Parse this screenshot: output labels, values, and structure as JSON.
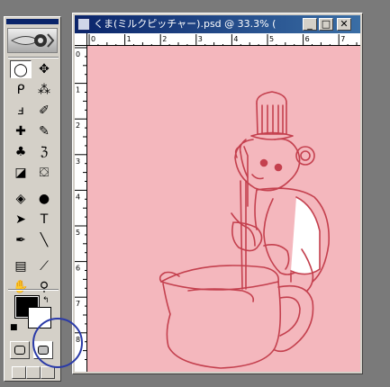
{
  "document": {
    "title": "くま(ミルクピッチャー).psd @ 33.3% (",
    "zoom": "33.3%",
    "canvas_color": "#f4b7bd",
    "line_color": "#c4404e"
  },
  "window_controls": {
    "minimize": "_",
    "maximize": "□",
    "close": "✕"
  },
  "rulers": {
    "horizontal": [
      "0",
      "1",
      "2",
      "3",
      "4",
      "5",
      "6",
      "7"
    ],
    "vertical": [
      "0",
      "1",
      "2",
      "3",
      "4",
      "5",
      "6",
      "7",
      "8"
    ]
  },
  "toolbox": {
    "tools": [
      {
        "name": "marquee-tool",
        "glyph": "◯",
        "selected": true
      },
      {
        "name": "move-tool",
        "glyph": "✥"
      },
      {
        "name": "lasso-tool",
        "glyph": "ᑭ"
      },
      {
        "name": "magic-wand-tool",
        "glyph": "⁂"
      },
      {
        "name": "crop-tool",
        "glyph": "ⅎ"
      },
      {
        "name": "slice-tool",
        "glyph": "✐"
      },
      {
        "name": "healing-brush-tool",
        "glyph": "✚"
      },
      {
        "name": "brush-tool",
        "glyph": "✎"
      },
      {
        "name": "stamp-tool",
        "glyph": "♣"
      },
      {
        "name": "history-brush-tool",
        "glyph": "ℨ"
      },
      {
        "name": "eraser-tool",
        "glyph": "◪"
      },
      {
        "name": "paint-bucket-tool",
        "glyph": "⛋"
      },
      {
        "name": "blur-tool",
        "glyph": "◈"
      },
      {
        "name": "dodge-tool",
        "glyph": "●"
      },
      {
        "name": "path-selection-tool",
        "glyph": "➤"
      },
      {
        "name": "type-tool",
        "glyph": "T"
      },
      {
        "name": "pen-tool",
        "glyph": "✒"
      },
      {
        "name": "line-tool",
        "glyph": "╲"
      },
      {
        "name": "notes-tool",
        "glyph": "▤"
      },
      {
        "name": "eyedropper-tool",
        "glyph": "⟋"
      },
      {
        "name": "hand-tool",
        "glyph": "✋"
      },
      {
        "name": "zoom-tool",
        "glyph": "⚲"
      }
    ],
    "foreground_color": "#000000",
    "background_color": "#ffffff",
    "swap_glyph": "↰",
    "default_colors_glyph": "■"
  },
  "annotation": {
    "circle_color": "#2a3aa8"
  }
}
